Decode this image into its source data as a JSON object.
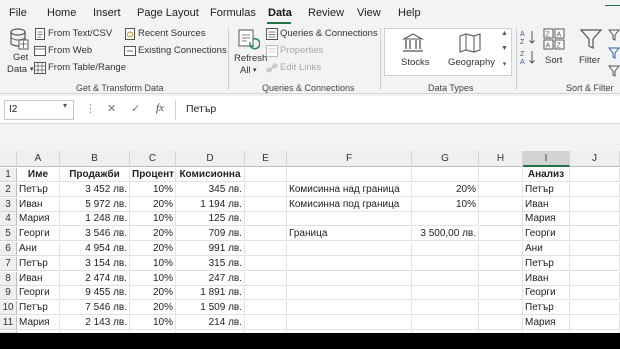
{
  "tabs": [
    "File",
    "Home",
    "Insert",
    "Page Layout",
    "Formulas",
    "Data",
    "Review",
    "View",
    "Help"
  ],
  "active_tab": "Data",
  "ribbon": {
    "get_data": {
      "line1": "Get",
      "line2": "Data"
    },
    "from_text_csv": "From Text/CSV",
    "from_web": "From Web",
    "from_table_range": "From Table/Range",
    "recent_sources": "Recent Sources",
    "existing_connections": "Existing Connections",
    "group_get_transform": "Get & Transform Data",
    "refresh": {
      "line1": "Refresh",
      "line2": "All"
    },
    "queries_connections": "Queries & Connections",
    "properties": "Properties",
    "edit_links": "Edit Links",
    "group_queries": "Queries & Connections",
    "stocks": "Stocks",
    "geography": "Geography",
    "group_data_types": "Data Types",
    "sort": "Sort",
    "filter": "Filter",
    "group_sort_filter": "Sort & Filter"
  },
  "formula_bar": {
    "name_box": "I2",
    "cancel": "✕",
    "enter": "✓",
    "fx": "fx",
    "content": "Петър"
  },
  "grid": {
    "columns": [
      "A",
      "B",
      "C",
      "D",
      "E",
      "F",
      "G",
      "H",
      "I",
      "J"
    ],
    "selected_column": "I",
    "rows": [
      "1",
      "2",
      "3",
      "4",
      "5",
      "6",
      "7",
      "8",
      "9",
      "10",
      "11",
      "12"
    ],
    "cells": {
      "A": [
        "Име",
        "Петър",
        "Иван",
        "Мария",
        "Георги",
        "Ани",
        "Петър",
        "Иван",
        "Георги",
        "Петър",
        "Мария",
        "Мария"
      ],
      "B": [
        "Продажби",
        "3 452 лв.",
        "5 972 лв.",
        "1 248 лв.",
        "3 546 лв.",
        "4 954 лв.",
        "3 154 лв.",
        "2 474 лв.",
        "9 455 лв.",
        "7 546 лв.",
        "2 143 лв.",
        "2 456 лв."
      ],
      "C": [
        "Процент",
        "10%",
        "20%",
        "10%",
        "20%",
        "20%",
        "10%",
        "10%",
        "20%",
        "20%",
        "10%",
        "10%"
      ],
      "D": [
        "Комисионна",
        "345 лв.",
        "1 194 лв.",
        "125 лв.",
        "709 лв.",
        "991 лв.",
        "315 лв.",
        "247 лв.",
        "1 891 лв.",
        "1 509 лв.",
        "214 лв.",
        "246 лв."
      ],
      "F": [
        "",
        "Комисинна над граница",
        "Комисинна под граница",
        "",
        "Граница",
        "",
        "",
        "",
        "",
        "",
        "",
        ""
      ],
      "G": [
        "",
        "20%",
        "10%",
        "",
        "3 500,00 лв.",
        "",
        "",
        "",
        "",
        "",
        "",
        ""
      ],
      "I": [
        "Анализ",
        "Петър",
        "Иван",
        "Мария",
        "Георги",
        "Ани",
        "Петър",
        "Иван",
        "Георги",
        "Петър",
        "Мария",
        "Мария"
      ]
    }
  }
}
